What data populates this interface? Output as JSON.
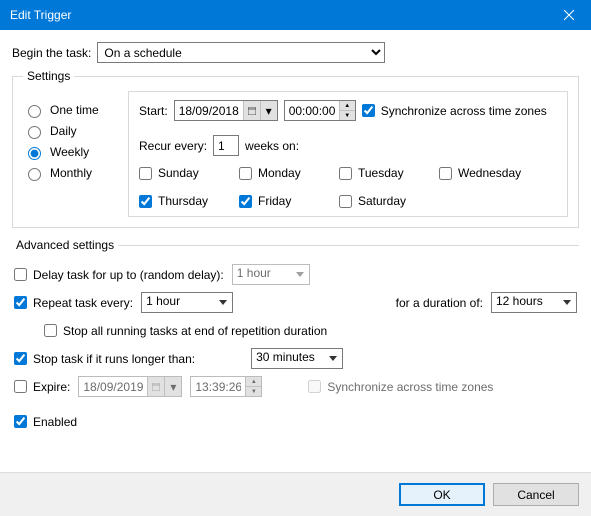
{
  "title": "Edit Trigger",
  "begin": {
    "label": "Begin the task:",
    "value": "On a schedule"
  },
  "settings": {
    "legend": "Settings",
    "freq": {
      "one_time": "One time",
      "daily": "Daily",
      "weekly": "Weekly",
      "monthly": "Monthly",
      "selected": "weekly"
    },
    "start_label": "Start:",
    "start_date": "18/09/2018",
    "start_time": "00:00:00",
    "sync_tz": "Synchronize across time zones",
    "recur_label": "Recur every:",
    "recur_value": "1",
    "recur_suffix": "weeks on:",
    "days": {
      "sun": "Sunday",
      "mon": "Monday",
      "tue": "Tuesday",
      "wed": "Wednesday",
      "thu": "Thursday",
      "fri": "Friday",
      "sat": "Saturday"
    }
  },
  "adv": {
    "legend": "Advanced settings",
    "delay_label": "Delay task for up to (random delay):",
    "delay_value": "1 hour",
    "repeat_label": "Repeat task every:",
    "repeat_value": "1 hour",
    "duration_label": "for a duration of:",
    "duration_value": "12 hours",
    "stop_all": "Stop all running tasks at end of repetition duration",
    "stop_long_label": "Stop task if it runs longer than:",
    "stop_long_value": "30 minutes",
    "expire_label": "Expire:",
    "expire_date": "18/09/2019",
    "expire_time": "13:39:26",
    "sync_tz2": "Synchronize across time zones",
    "enabled": "Enabled"
  },
  "buttons": {
    "ok": "OK",
    "cancel": "Cancel"
  }
}
